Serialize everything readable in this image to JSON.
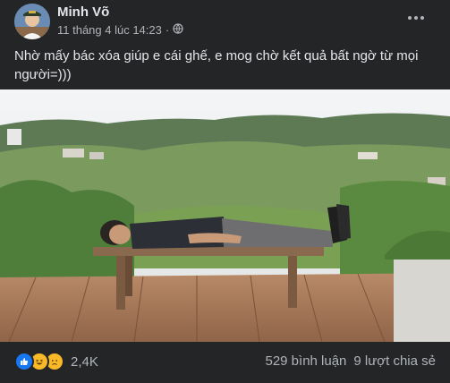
{
  "post": {
    "author": "Minh Võ",
    "timestamp": "11 tháng 4 lúc 14:23",
    "separator": "·",
    "privacy_icon": "globe-icon",
    "caption": "Nhờ mấy bác xóa giúp e cái ghế, e mog chờ kết quả bất ngờ từ mọi người=)))",
    "reactions": {
      "types": [
        "like",
        "haha",
        "sad"
      ],
      "count": "2,4K"
    },
    "comments": "529 bình luận",
    "shares": "9 lượt chia sẻ"
  },
  "colors": {
    "background": "#242526",
    "text_primary": "#e4e6eb",
    "text_secondary": "#b0b3b8",
    "like_blue": "#1877f2",
    "emoji_yellow": "#f7b928"
  }
}
